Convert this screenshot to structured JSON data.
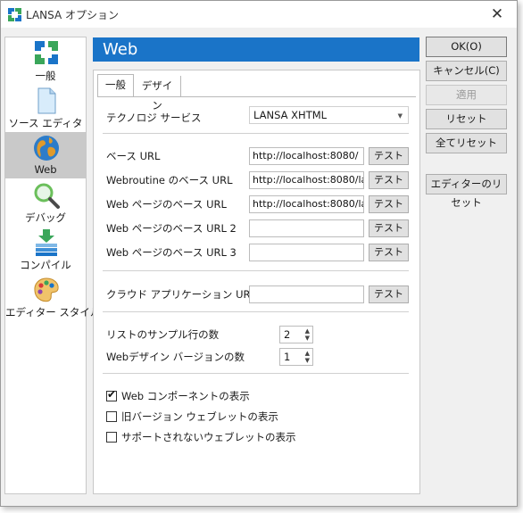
{
  "window": {
    "title": "LANSA オプション"
  },
  "sidebar": {
    "items": [
      {
        "label": "一般",
        "icon": "general-icon"
      },
      {
        "label": "ソース エディタ",
        "icon": "document-icon"
      },
      {
        "label": "Web",
        "icon": "globe-icon",
        "selected": true
      },
      {
        "label": "デバッグ",
        "icon": "magnifier-icon"
      },
      {
        "label": "コンパイル",
        "icon": "compile-icon"
      },
      {
        "label": "エディター スタイル",
        "icon": "palette-icon"
      }
    ]
  },
  "header": {
    "title": "Web"
  },
  "tabs": [
    {
      "label": "一般",
      "active": true
    },
    {
      "label": "デザイン",
      "active": false
    }
  ],
  "form": {
    "tech_service": {
      "label": "テクノロジ サービス",
      "value": "LANSA XHTML"
    },
    "test_label": "テスト",
    "urls": [
      {
        "label": "ベース URL",
        "value": "http://localhost:8080/"
      },
      {
        "label": "Webroutine のベース URL",
        "value": "http://localhost:8080/la"
      },
      {
        "label": "Web ページのベース URL",
        "value": "http://localhost:8080/la"
      },
      {
        "label": "Web ページのベース URL 2",
        "value": ""
      },
      {
        "label": "Web ページのベース URL 3",
        "value": ""
      }
    ],
    "cloud_url": {
      "label": "クラウド アプリケーション URL",
      "value": ""
    },
    "sample_rows": {
      "label": "リストのサンプル行の数",
      "value": "2"
    },
    "design_versions": {
      "label": "Webデザイン バージョンの数",
      "value": "1"
    },
    "checkboxes": [
      {
        "label": "Web コンポーネントの表示",
        "checked": true
      },
      {
        "label": "旧バージョン ウェブレットの表示",
        "checked": false
      },
      {
        "label": "サポートされないウェブレットの表示",
        "checked": false
      }
    ]
  },
  "buttons": {
    "ok": "OK(O)",
    "cancel": "キャンセル(C)",
    "apply": "適用",
    "reset": "リセット",
    "reset_all": "全てリセット",
    "editor_reset": "エディターのリセット"
  },
  "colors": {
    "accent": "#1a74c8",
    "selected_bg": "#c9c9c9"
  }
}
